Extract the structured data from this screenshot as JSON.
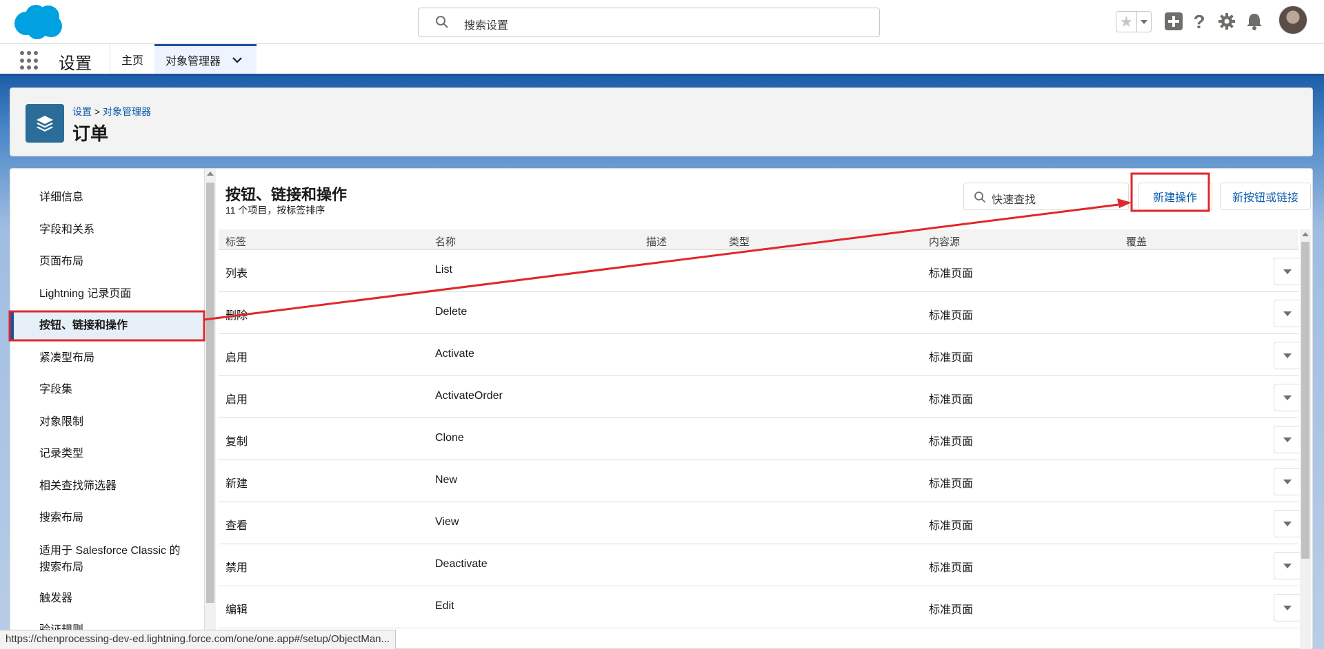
{
  "header": {
    "search_placeholder": "搜索设置"
  },
  "nav": {
    "app_name": "设置",
    "tab_home": "主页",
    "tab_object_manager": "对象管理器"
  },
  "page": {
    "breadcrumb_setup": "设置",
    "breadcrumb_sep": ">",
    "breadcrumb_object_manager": "对象管理器",
    "title": "订单"
  },
  "sidebar": {
    "items": [
      {
        "label": "详细信息"
      },
      {
        "label": "字段和关系"
      },
      {
        "label": "页面布局"
      },
      {
        "label": "Lightning 记录页面"
      },
      {
        "label": "按钮、链接和操作"
      },
      {
        "label": "紧凑型布局"
      },
      {
        "label": "字段集"
      },
      {
        "label": "对象限制"
      },
      {
        "label": "记录类型"
      },
      {
        "label": "相关查找筛选器"
      },
      {
        "label": "搜索布局"
      },
      {
        "label": "适用于 Salesforce Classic 的搜索布局"
      },
      {
        "label": "触发器"
      },
      {
        "label": "验证规则"
      }
    ],
    "active_index": 4
  },
  "section": {
    "title": "按钮、链接和操作",
    "subtitle": "11 个项目，按标签排序",
    "quick_find_placeholder": "快速查找",
    "new_action_label": "新建操作",
    "new_button_label": "新按钮或链接"
  },
  "table": {
    "columns": [
      "标签",
      "名称",
      "描述",
      "类型",
      "内容源",
      "覆盖"
    ],
    "rows": [
      {
        "label": "列表",
        "name": "List",
        "source": "标准页面"
      },
      {
        "label": "删除",
        "name": "Delete",
        "source": "标准页面"
      },
      {
        "label": "启用",
        "name": "Activate",
        "source": "标准页面"
      },
      {
        "label": "启用",
        "name": "ActivateOrder",
        "source": "标准页面"
      },
      {
        "label": "复制",
        "name": "Clone",
        "source": "标准页面"
      },
      {
        "label": "新建",
        "name": "New",
        "source": "标准页面"
      },
      {
        "label": "查看",
        "name": "View",
        "source": "标准页面"
      },
      {
        "label": "禁用",
        "name": "Deactivate",
        "source": "标准页面"
      },
      {
        "label": "编辑",
        "name": "Edit",
        "source": "标准页面"
      }
    ]
  },
  "status_bar": {
    "url": "https://chenprocessing-dev-ed.lightning.force.com/one/one.app#/setup/ObjectMan..."
  },
  "colors": {
    "brand_blue": "#1b5297",
    "link_blue": "#0b5cab",
    "annotation_red": "#e0272b",
    "salesforce_cloud": "#00a1e0"
  }
}
